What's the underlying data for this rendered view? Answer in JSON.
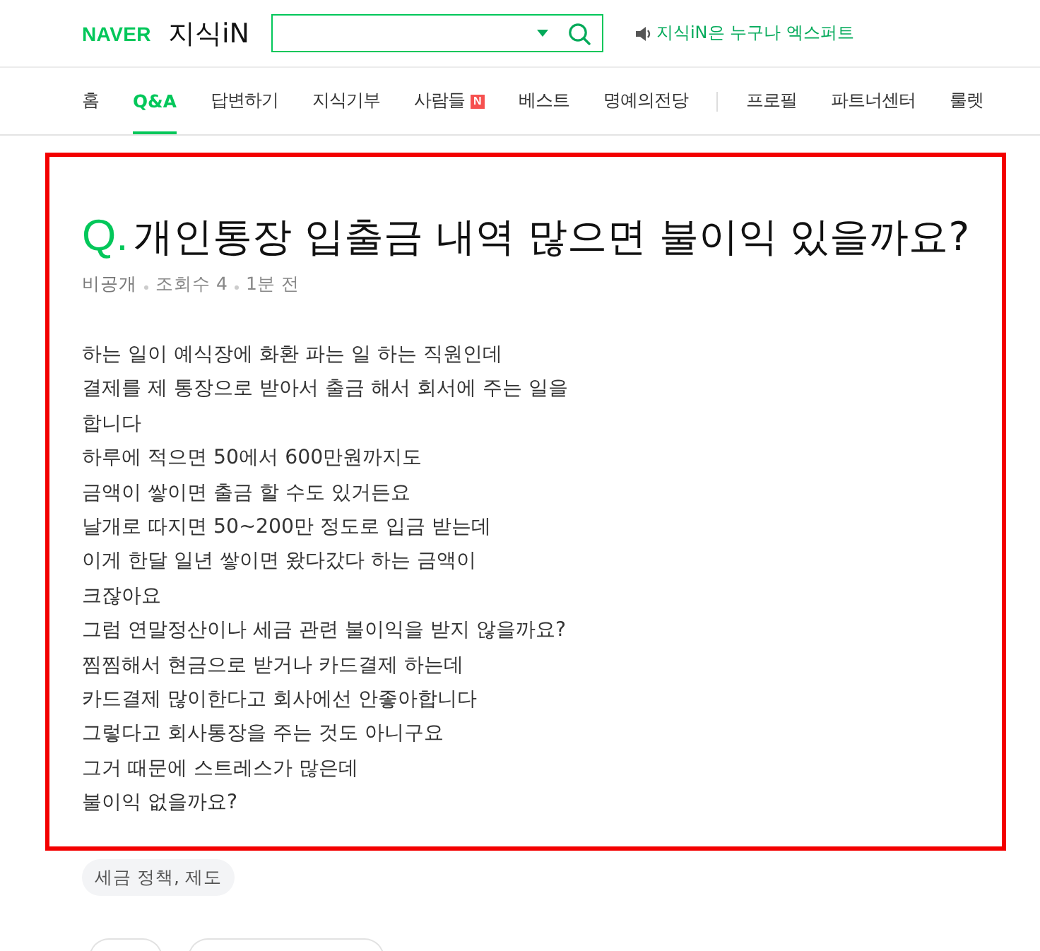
{
  "header": {
    "logo": {
      "brand": "NAVER",
      "service": "지식iN"
    },
    "notice": "지식iN은 누구나 엑스퍼트"
  },
  "nav": {
    "items": [
      {
        "label": "홈",
        "selected": false
      },
      {
        "label": "Q&A",
        "selected": true
      },
      {
        "label": "답변하기",
        "selected": false
      },
      {
        "label": "지식기부",
        "selected": false
      },
      {
        "label": "사람들",
        "selected": false,
        "badge": "N"
      },
      {
        "label": "베스트",
        "selected": false
      },
      {
        "label": "명예의전당",
        "selected": false
      }
    ],
    "extra_items": [
      {
        "label": "프로필",
        "selected": false
      },
      {
        "label": "파트너센터",
        "selected": false
      },
      {
        "label": "룰렛",
        "selected": false
      }
    ]
  },
  "question": {
    "mark": "Q.",
    "title": "개인통장 입출금 내역 많으면 불이익 있을까요?",
    "meta": [
      "비공개",
      "조회수 4",
      "1분 전"
    ],
    "body_lines": [
      "하는 일이 예식장에 화환 파는 일 하는 직원인데",
      "결제를 제 통장으로 받아서 출금 해서 회서에 주는 일을",
      "합니다",
      "하루에 적으면 50에서 600만원까지도",
      "금액이 쌓이면 출금 할 수도 있거든요",
      "날개로 따지면 50~200만 정도로 입금 받는데",
      "이게 한달 일년 쌓이면 왔다갔다 하는 금액이",
      "크잖아요",
      "그럼 연말정산이나 세금 관련 불이익을 받지 않을까요?",
      "찜찜해서 현금으로 받거나 카드결제 하는데",
      "카드결제 많이한다고 회사에선 안좋아합니다",
      "그렇다고 회사통장을 주는 것도 아니구요",
      "그거 때문에 스트레스가 많은데",
      "불이익 없을까요?"
    ],
    "tags": [
      "세금 정책, 제도"
    ]
  }
}
